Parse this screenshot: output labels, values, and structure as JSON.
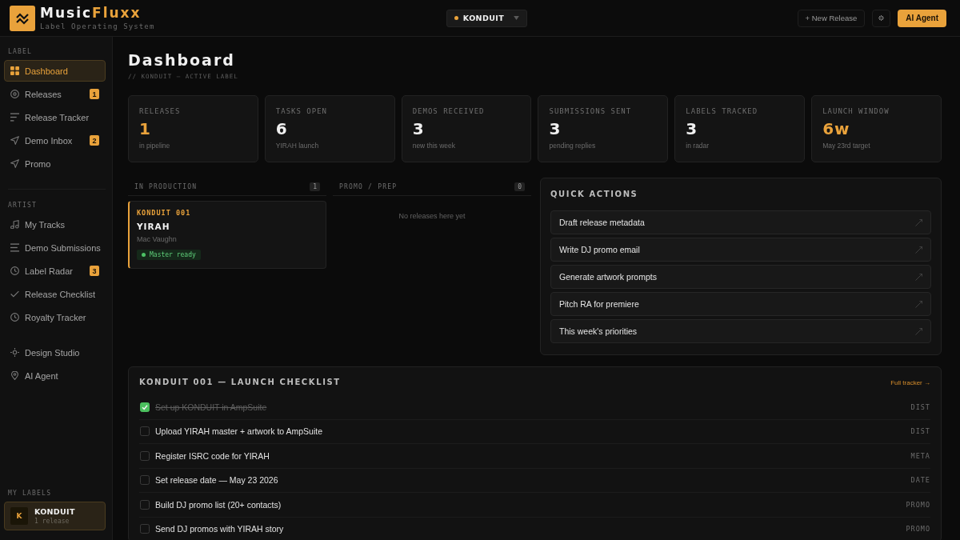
{
  "brand": {
    "name": "Music",
    "name_accent": "Fluxx",
    "subtitle": "Label Operating System"
  },
  "label_switcher": {
    "label": "KONDUIT"
  },
  "header_buttons": [
    {
      "kind": "outline",
      "label": "+ New Release"
    },
    {
      "kind": "icon"
    },
    {
      "kind": "primary",
      "label": "AI Agent"
    }
  ],
  "sidebar": {
    "sections": [
      {
        "title": "LABEL",
        "items": [
          {
            "label": "Dashboard",
            "selected": true
          },
          {
            "label": "Releases",
            "selected": false,
            "badge": "1"
          },
          {
            "label": "Release Tracker",
            "selected": false
          },
          {
            "label": "Demo Inbox",
            "selected": false,
            "badge": "2"
          },
          {
            "label": "Promo",
            "selected": false
          }
        ]
      },
      {
        "title": "ARTIST",
        "items": [
          {
            "label": "My Tracks",
            "selected": false
          },
          {
            "label": "Demo Submissions",
            "selected": false
          },
          {
            "label": "Label Radar",
            "selected": false,
            "badge": "3"
          },
          {
            "label": "Release Checklist",
            "selected": false
          },
          {
            "label": "Royalty Tracker",
            "selected": false
          }
        ]
      },
      {
        "items": [
          {
            "label": "Design Studio",
            "selected": false
          },
          {
            "label": "AI Agent",
            "selected": false
          }
        ]
      }
    ],
    "my_labels": {
      "title": "MY LABELS",
      "items": [
        {
          "initial": "K",
          "name": "KONDUIT",
          "meta": "1 release",
          "selected": true
        }
      ]
    }
  },
  "page": {
    "title": "Dashboard",
    "subtitle": "// KONDUIT — ACTIVE LABEL"
  },
  "stats": [
    {
      "label": "RELEASES",
      "value": "1",
      "note": "in pipeline",
      "accent": true
    },
    {
      "label": "TASKS OPEN",
      "value": "6",
      "note": "YIRAH launch",
      "accent": false
    },
    {
      "label": "DEMOS RECEIVED",
      "value": "3",
      "note": "new this week",
      "accent": false
    },
    {
      "label": "SUBMISSIONS SENT",
      "value": "3",
      "note": "pending replies",
      "accent": false
    },
    {
      "label": "LABELS TRACKED",
      "value": "3",
      "note": "in radar",
      "accent": false
    },
    {
      "label": "LAUNCH WINDOW",
      "value": "6w",
      "note": "May 23rd target",
      "accent": true
    }
  ],
  "board": {
    "columns": [
      {
        "title": "IN PRODUCTION",
        "count": "1",
        "cards": [
          {
            "code": "KONDUIT 001",
            "title": "YIRAH",
            "artist": "Mac Vaughn",
            "status": "Master ready"
          }
        ]
      },
      {
        "title": "PROMO / PREP",
        "count": "0",
        "empty_text": "No releases here yet"
      }
    ]
  },
  "quick_actions": {
    "title": "QUICK ACTIONS",
    "items": [
      "Draft release metadata",
      "Write DJ promo email",
      "Generate artwork prompts",
      "Pitch RA for premiere",
      "This week's priorities"
    ]
  },
  "checklist": {
    "title": "KONDUIT 001 — LAUNCH CHECKLIST",
    "link": "Full tracker →",
    "tasks": [
      {
        "label": "Set up KONDUIT in AmpSuite",
        "tag": "DIST",
        "checked": true
      },
      {
        "label": "Upload YIRAH master + artwork to AmpSuite",
        "tag": "DIST",
        "checked": false
      },
      {
        "label": "Register ISRC code for YIRAH",
        "tag": "META",
        "checked": false
      },
      {
        "label": "Set release date — May 23 2026",
        "tag": "DATE",
        "checked": false
      },
      {
        "label": "Build DJ promo list (20+ contacts)",
        "tag": "PROMO",
        "checked": false
      },
      {
        "label": "Send DJ promos with YIRAH story",
        "tag": "PROMO",
        "checked": false
      }
    ]
  }
}
